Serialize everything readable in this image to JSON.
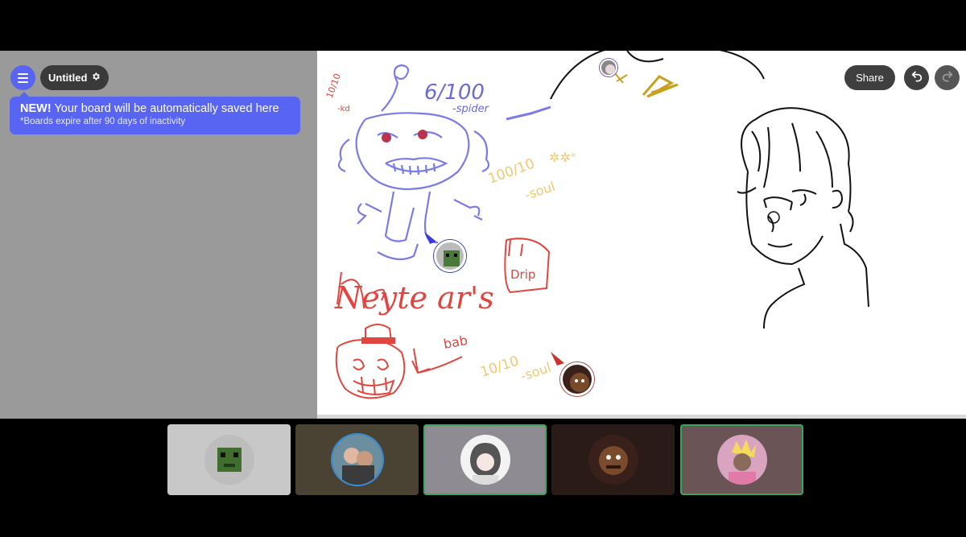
{
  "app": {
    "board_title": "Untitled",
    "menu_icon": "hamburger-icon",
    "settings_icon": "gear-icon"
  },
  "notice": {
    "strong": "NEW!",
    "message": " Your board will be automatically saved here",
    "subtext": "*Boards expire after 90 days of inactivity"
  },
  "toolbar": {
    "share_label": "Share",
    "undo_icon": "undo-icon",
    "redo_icon": "redo-icon"
  },
  "board_annotations": {
    "score_top": "6/100",
    "score_top_author": "-spider",
    "score_soul_1": "100/10",
    "score_soul_1_author": "-soul",
    "drip_label": "Drip",
    "big_word": "Neyte ar's",
    "bab_label": "bab",
    "score_soul_2": "10/10",
    "score_soul_2_author": "-soul",
    "corner_mark": "10/10",
    "corner_author": "-kd"
  },
  "participants": [
    {
      "name": "participant-1",
      "bg": "#c8c8c8",
      "speaking": false
    },
    {
      "name": "participant-2",
      "bg": "#4a4233",
      "speaking": false
    },
    {
      "name": "participant-3",
      "bg": "#8e8b93",
      "speaking": true
    },
    {
      "name": "participant-4",
      "bg": "#2a1a18",
      "speaking": false
    },
    {
      "name": "participant-5",
      "bg": "#6a5456",
      "speaking": true
    }
  ],
  "colors": {
    "accent": "#5865f2",
    "speaking": "#3ba55d",
    "ink_blue": "#7b7be6",
    "ink_red": "#e0463f",
    "ink_yellow": "#f0c872",
    "ink_black": "#111111"
  }
}
